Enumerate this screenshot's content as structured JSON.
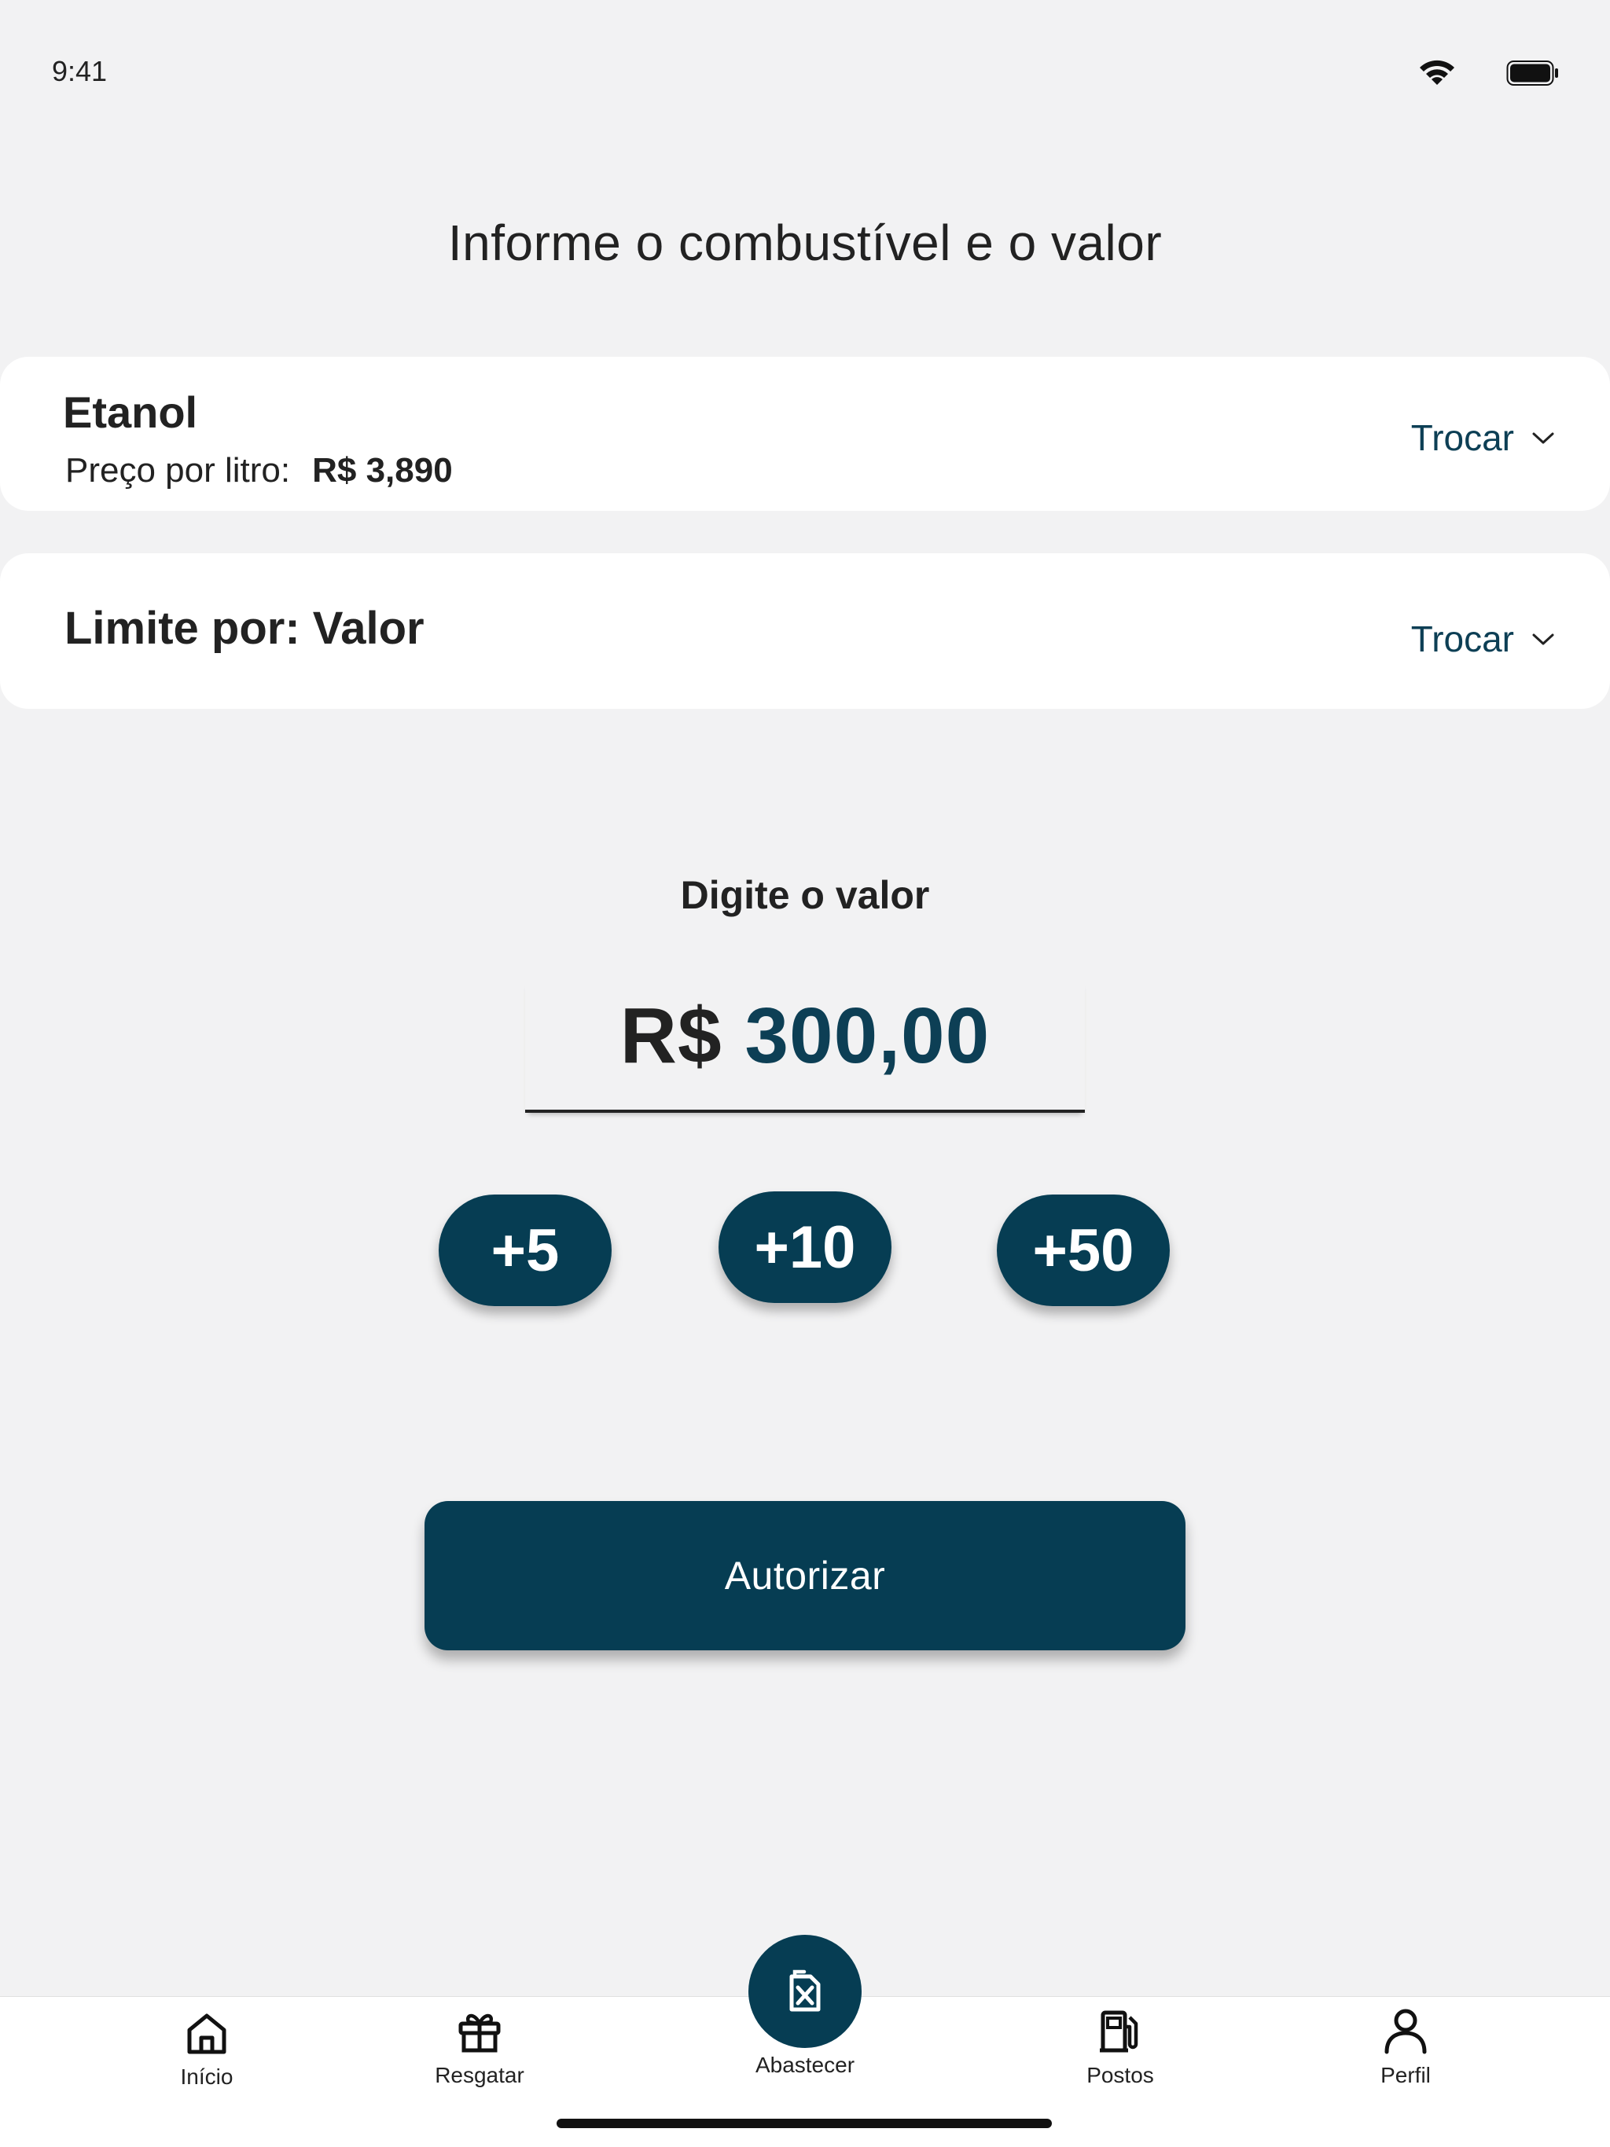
{
  "status_bar": {
    "time": "9:41",
    "wifi_icon": "wifi-icon",
    "battery_icon": "battery-icon"
  },
  "header": {
    "title": "Informe o combustível e o valor"
  },
  "fuel_card": {
    "fuel_name": "Etanol",
    "price_label": "Preço por litro:",
    "price_value": "R$ 3,890",
    "change_label": "Trocar"
  },
  "limit_card": {
    "label": "Limite por: Valor",
    "change_label": "Trocar"
  },
  "value_input": {
    "label": "Digite o valor",
    "currency": "R$",
    "amount": "300,00"
  },
  "quick_add": [
    {
      "label": "+5"
    },
    {
      "label": "+10"
    },
    {
      "label": "+50"
    }
  ],
  "authorize_button": {
    "label": "Autorizar"
  },
  "tabbar": {
    "items": [
      {
        "label": "Início",
        "icon": "home-icon"
      },
      {
        "label": "Resgatar",
        "icon": "gift-icon"
      },
      {
        "label": "Abastecer",
        "icon": "fuel-can-icon"
      },
      {
        "label": "Postos",
        "icon": "fuel-pump-icon"
      },
      {
        "label": "Perfil",
        "icon": "user-icon"
      }
    ]
  },
  "colors": {
    "primary": "#063d53",
    "accent_text": "#0d3f55",
    "background": "#f2f2f3",
    "card": "#ffffff"
  }
}
